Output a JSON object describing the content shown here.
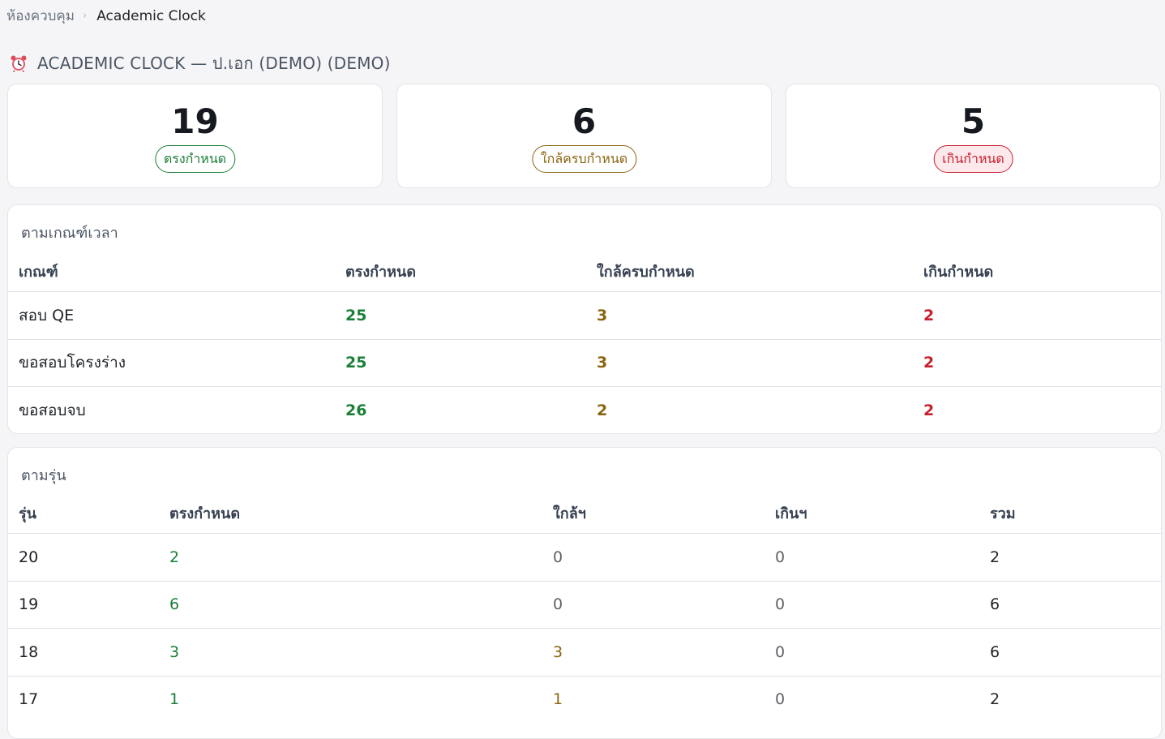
{
  "breadcrumb": {
    "home": "ห้องควบคุม",
    "current": "Academic Clock"
  },
  "page": {
    "title": "ACADEMIC CLOCK — ป.เอก (DEMO) (DEMO)"
  },
  "stats": [
    {
      "value": "19",
      "label": "ตรงกำหนด",
      "status": "green"
    },
    {
      "value": "6",
      "label": "ใกล้ครบกำหนด",
      "status": "amber"
    },
    {
      "value": "5",
      "label": "เกินกำหนด",
      "status": "red"
    }
  ],
  "criteria": {
    "title": "ตามเกณฑ์เวลา",
    "headers": [
      "เกณฑ์",
      "ตรงกำหนด",
      "ใกล้ครบกำหนด",
      "เกินกำหนด"
    ],
    "rows": [
      {
        "name": "สอบ QE",
        "on_time": "25",
        "near": "3",
        "over": "2"
      },
      {
        "name": "ขอสอบโครงร่าง",
        "on_time": "25",
        "near": "3",
        "over": "2"
      },
      {
        "name": "ขอสอบจบ",
        "on_time": "26",
        "near": "2",
        "over": "2"
      }
    ]
  },
  "cohort": {
    "title": "ตามรุ่น",
    "headers": [
      "รุ่น",
      "ตรงกำหนด",
      "ใกล้ฯ",
      "เกินฯ",
      "รวม"
    ],
    "rows": [
      {
        "cohort": "20",
        "on_time": "2",
        "near": "0",
        "over": "0",
        "total": "2"
      },
      {
        "cohort": "19",
        "on_time": "6",
        "near": "0",
        "over": "0",
        "total": "6"
      },
      {
        "cohort": "18",
        "on_time": "3",
        "near": "3",
        "over": "0",
        "total": "6"
      },
      {
        "cohort": "17",
        "on_time": "1",
        "near": "1",
        "over": "0",
        "total": "2"
      }
    ]
  },
  "colors": {
    "on_time": "#1a7f37",
    "near": "#8a6510",
    "over": "#c8202f"
  },
  "icons": {
    "title_icon": "alarm-clock-icon",
    "breadcrumb_separator": "chevron-right-icon"
  }
}
